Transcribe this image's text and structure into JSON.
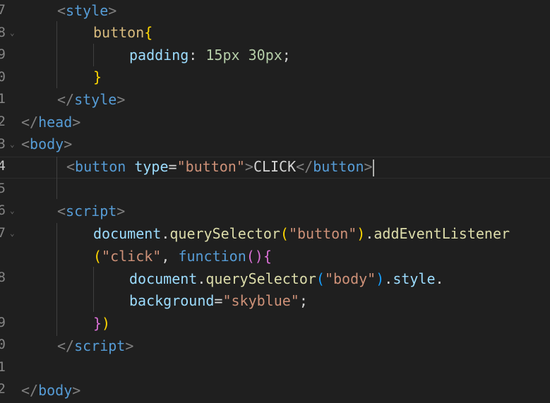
{
  "gutter": [
    "7",
    "8",
    "9",
    "0",
    "1",
    "2",
    "3",
    "4",
    "5",
    "6",
    "7",
    "",
    "8",
    "",
    "9",
    "0",
    "1",
    "2"
  ],
  "code": {
    "l1": {
      "open": "<",
      "tag": "style",
      "close": ">"
    },
    "l2": {
      "sel": "button",
      "brace": "{"
    },
    "l3": {
      "prop": "padding",
      "colon": ":",
      "v1": "15px",
      "v2": "30px",
      "semi": ";"
    },
    "l4": {
      "brace": "}"
    },
    "l5": {
      "open": "</",
      "tag": "style",
      "close": ">"
    },
    "l6": {
      "open": "</",
      "tag": "head",
      "close": ">"
    },
    "l7": {
      "open": "<",
      "tag": "body",
      "close": ">"
    },
    "l8": {
      "open": "<",
      "tag": "button",
      "attr": "type",
      "eq": "=",
      "val": "\"button\"",
      "gt": ">",
      "text": "CLICK",
      "copen": "</",
      "ctag": "button",
      "cgt": ">"
    },
    "l10": {
      "open": "<",
      "tag": "script",
      "close": ">"
    },
    "l11": {
      "obj": "document",
      "dot": ".",
      "fn": "querySelector",
      "p1": "(",
      "arg": "\"button\"",
      "p2": ")",
      "dot2": ".",
      "fn2": "addEventListener"
    },
    "l12": {
      "p": "(",
      "arg": "\"click\"",
      "comma": ",",
      "kw": "function",
      "pp": "()",
      "brace": "{"
    },
    "l13": {
      "obj": "document",
      "dot": ".",
      "fn": "querySelector",
      "p1": "(",
      "arg": "\"body\"",
      "p2": ")",
      "dot2": ".",
      "prop": "style",
      "dot3": "."
    },
    "l14": {
      "prop": "background",
      "eq": "=",
      "val": "\"skyblue\"",
      "semi": ";"
    },
    "l15": {
      "brace": "}",
      "paren": ")"
    },
    "l16": {
      "open": "</",
      "tag": "script",
      "close": ">"
    },
    "l18": {
      "open": "</",
      "tag": "body",
      "close": ">"
    }
  }
}
